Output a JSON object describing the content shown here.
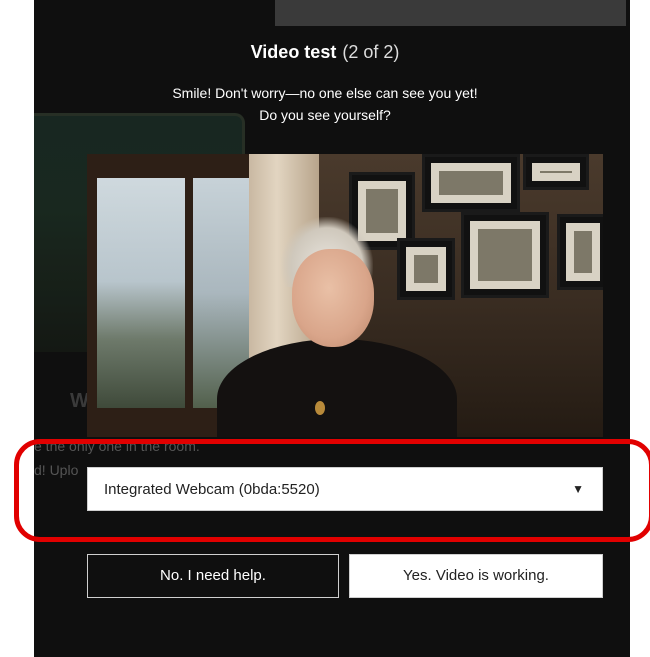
{
  "dialog": {
    "title": "Video test",
    "step": "(2 of 2)",
    "message_line1": "Smile! Don't worry—no one else can see you yet!",
    "message_line2": "Do you see yourself?"
  },
  "background": {
    "welcome_fragment": "W",
    "line1_fragment": "e the only one in the room.",
    "line2_fragment": "d! Uplo"
  },
  "camera_select": {
    "selected": "Integrated Webcam (0bda:5520)",
    "caret_icon": "chevron-down-icon"
  },
  "buttons": {
    "no": "No. I need help.",
    "yes": "Yes. Video is working."
  },
  "colors": {
    "panel": "#0f0f0f",
    "highlight": "#e10000"
  }
}
